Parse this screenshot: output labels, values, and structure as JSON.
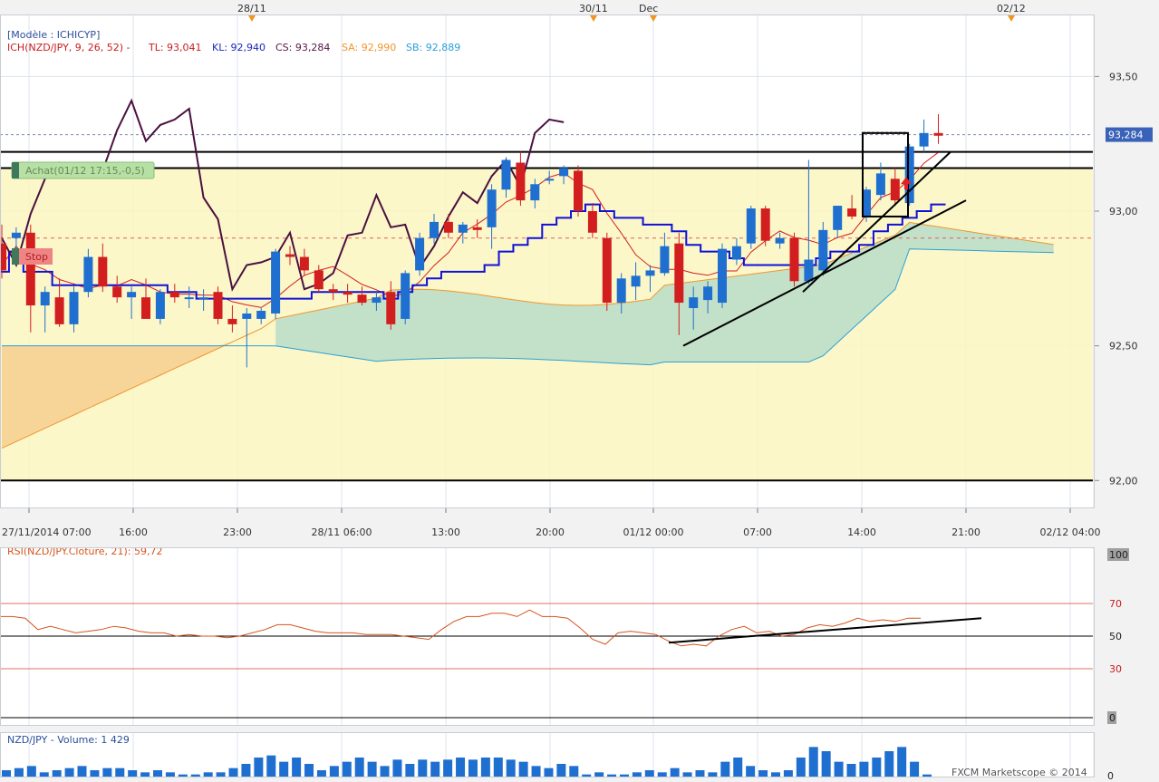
{
  "header": {
    "model_label": "[Modèle : ICHICYP]",
    "indicator_name": "ICH(NZD/JPY, 9, 26, 52) -",
    "tl": "TL: 93,041",
    "kl": "KL: 92,940",
    "cs": "CS: 93,284",
    "sa": "SA: 92,990",
    "sb": "SB: 92,889"
  },
  "top_dates": [
    {
      "label": "28/11",
      "marker": true
    },
    {
      "label": "30/11",
      "marker": true
    },
    {
      "label": "Dec",
      "marker": true
    },
    {
      "label": "02/12",
      "marker": true
    }
  ],
  "orders": {
    "buy_label": "Achat(01/12 17:15,-0,5)",
    "stop_label": "Stop"
  },
  "price_badge": "93,284",
  "rsi_label": "RSI(NZD/JPY.Cloture, 21): 59,72",
  "volume_label": "NZD/JPY - Volume: 1 429",
  "footer": "FXCM Marketscope © 2014",
  "colors": {
    "bull": "#1f6fd0",
    "bear": "#d21e1e",
    "tenkan": "#d21e1e",
    "kijun": "#1010d8",
    "chikou": "#4a1040",
    "senkou_a": "#f0962e",
    "senkou_b": "#2aa0d8",
    "cloud_bull": "#b8ddc8",
    "cloud_bear": "#f6cf90",
    "box_fill": "#fbf6c0",
    "rsi_line": "#d6541e",
    "volume": "#1f6fd0",
    "grid": "#dde3ec"
  },
  "chart_data": [
    {
      "type": "candlestick",
      "symbol": "NZD/JPY",
      "timeframe": "45m",
      "price_ticks": [
        "93,50",
        "93,00",
        "92,50",
        "92,00"
      ],
      "ylim": [
        91.9,
        93.73
      ],
      "time_ticks": [
        "27/11/2014 07:00",
        "16:00",
        "23:00",
        "28/11 06:00",
        "13:00",
        "20:00",
        "01/12 00:00",
        "07:00",
        "14:00",
        "21:00",
        "02/12 04:00"
      ],
      "candles": [
        [
          92.88,
          92.95,
          92.75,
          92.78
        ],
        [
          92.9,
          92.94,
          92.85,
          92.92
        ],
        [
          92.92,
          92.95,
          92.55,
          92.65
        ],
        [
          92.65,
          92.72,
          92.55,
          92.7
        ],
        [
          92.68,
          92.75,
          92.57,
          92.58
        ],
        [
          92.58,
          92.72,
          92.55,
          92.7
        ],
        [
          92.7,
          92.86,
          92.68,
          92.83
        ],
        [
          92.83,
          92.88,
          92.7,
          92.72
        ],
        [
          92.72,
          92.76,
          92.66,
          92.68
        ],
        [
          92.68,
          92.72,
          92.6,
          92.7
        ],
        [
          92.68,
          92.75,
          92.63,
          92.6
        ],
        [
          92.6,
          92.71,
          92.58,
          92.7
        ],
        [
          92.7,
          92.73,
          92.66,
          92.68
        ],
        [
          92.68,
          92.72,
          92.64,
          92.68
        ],
        [
          92.68,
          92.71,
          92.63,
          92.68
        ],
        [
          92.7,
          92.72,
          92.58,
          92.6
        ],
        [
          92.6,
          92.65,
          92.55,
          92.58
        ],
        [
          92.6,
          92.64,
          92.42,
          92.62
        ],
        [
          92.6,
          92.64,
          92.58,
          92.63
        ],
        [
          92.62,
          92.86,
          92.6,
          92.85
        ],
        [
          92.84,
          92.87,
          92.8,
          92.83
        ],
        [
          92.83,
          92.86,
          92.76,
          92.78
        ],
        [
          92.78,
          92.8,
          92.7,
          92.71
        ],
        [
          92.71,
          92.73,
          92.67,
          92.7
        ],
        [
          92.7,
          92.73,
          92.66,
          92.69
        ],
        [
          92.69,
          92.72,
          92.65,
          92.66
        ],
        [
          92.66,
          92.7,
          92.63,
          92.68
        ],
        [
          92.7,
          92.74,
          92.56,
          92.58
        ],
        [
          92.6,
          92.78,
          92.58,
          92.77
        ],
        [
          92.78,
          92.92,
          92.76,
          92.9
        ],
        [
          92.9,
          92.99,
          92.88,
          92.96
        ],
        [
          92.96,
          92.99,
          92.9,
          92.92
        ],
        [
          92.92,
          92.96,
          92.88,
          92.95
        ],
        [
          92.94,
          92.97,
          92.9,
          92.93
        ],
        [
          92.94,
          93.1,
          92.86,
          93.08
        ],
        [
          93.08,
          93.2,
          93.05,
          93.19
        ],
        [
          93.18,
          93.22,
          93.02,
          93.04
        ],
        [
          93.04,
          93.12,
          93.01,
          93.1
        ],
        [
          93.12,
          93.15,
          93.1,
          93.12
        ],
        [
          93.13,
          93.17,
          93.1,
          93.16
        ],
        [
          93.15,
          93.17,
          92.98,
          93.0
        ],
        [
          93.0,
          93.03,
          92.9,
          92.92
        ],
        [
          92.9,
          92.92,
          92.63,
          92.66
        ],
        [
          92.66,
          92.77,
          92.62,
          92.75
        ],
        [
          92.72,
          92.81,
          92.67,
          92.76
        ],
        [
          92.76,
          92.8,
          92.7,
          92.78
        ],
        [
          92.77,
          92.92,
          92.76,
          92.87
        ],
        [
          92.88,
          92.92,
          92.54,
          92.66
        ],
        [
          92.64,
          92.72,
          92.56,
          92.68
        ],
        [
          92.67,
          92.74,
          92.62,
          92.72
        ],
        [
          92.66,
          92.88,
          92.64,
          92.86
        ],
        [
          92.82,
          92.9,
          92.8,
          92.87
        ],
        [
          92.88,
          93.02,
          92.86,
          93.01
        ],
        [
          93.01,
          93.02,
          92.87,
          92.89
        ],
        [
          92.88,
          92.92,
          92.86,
          92.9
        ],
        [
          92.9,
          92.92,
          92.72,
          92.74
        ],
        [
          92.74,
          93.19,
          92.73,
          92.82
        ],
        [
          92.78,
          92.96,
          92.76,
          92.93
        ],
        [
          92.93,
          92.96,
          92.9,
          93.02
        ],
        [
          93.01,
          93.06,
          92.97,
          92.98
        ],
        [
          92.98,
          93.09,
          92.96,
          93.08
        ],
        [
          93.06,
          93.18,
          93.04,
          93.14
        ],
        [
          93.12,
          93.16,
          93.02,
          93.04
        ],
        [
          93.03,
          93.25,
          93.02,
          93.24
        ],
        [
          93.24,
          93.34,
          93.22,
          93.29
        ],
        [
          93.29,
          93.36,
          93.25,
          93.28
        ]
      ],
      "horizontal_levels": [
        93.22,
        93.16,
        92.0
      ],
      "buy_level": 93.284,
      "stop_level": 92.9
    },
    {
      "type": "line",
      "name": "RSI(NZD/JPY.Cloture, 21)",
      "levels": [
        "100",
        "70",
        "50",
        "30",
        "0"
      ],
      "ylim": [
        0,
        100
      ],
      "last_value": 59.72,
      "values": [
        62,
        62,
        61,
        54,
        56,
        54,
        52,
        53,
        54,
        56,
        55,
        53,
        52,
        52,
        50,
        51,
        50,
        50,
        49,
        50,
        52,
        54,
        57,
        57,
        55,
        53,
        52,
        52,
        52,
        51,
        51,
        51,
        50,
        49,
        48,
        54,
        59,
        62,
        62,
        64,
        64,
        62,
        66,
        62,
        62,
        61,
        55,
        48,
        45,
        52,
        53,
        52,
        51,
        47,
        44,
        45,
        44,
        50,
        54,
        56,
        52,
        53,
        50,
        51,
        55,
        57,
        56,
        58,
        61,
        59,
        60,
        59,
        61,
        61
      ]
    },
    {
      "type": "bar",
      "name": "Volume",
      "last_value": 1429,
      "values": [
        3,
        4,
        5,
        2,
        3,
        4,
        5,
        3,
        4,
        4,
        3,
        2,
        3,
        2,
        1,
        1,
        2,
        2,
        4,
        6,
        9,
        10,
        7,
        9,
        6,
        3,
        5,
        7,
        9,
        7,
        5,
        8,
        6,
        8,
        7,
        8,
        9,
        8,
        9,
        9,
        8,
        7,
        5,
        4,
        6,
        5,
        1,
        2,
        1,
        1,
        2,
        3,
        2,
        4,
        2,
        3,
        2,
        7,
        9,
        5,
        3,
        2,
        3,
        9,
        14,
        12,
        7,
        6,
        7,
        9,
        12,
        14,
        7,
        1
      ]
    }
  ]
}
